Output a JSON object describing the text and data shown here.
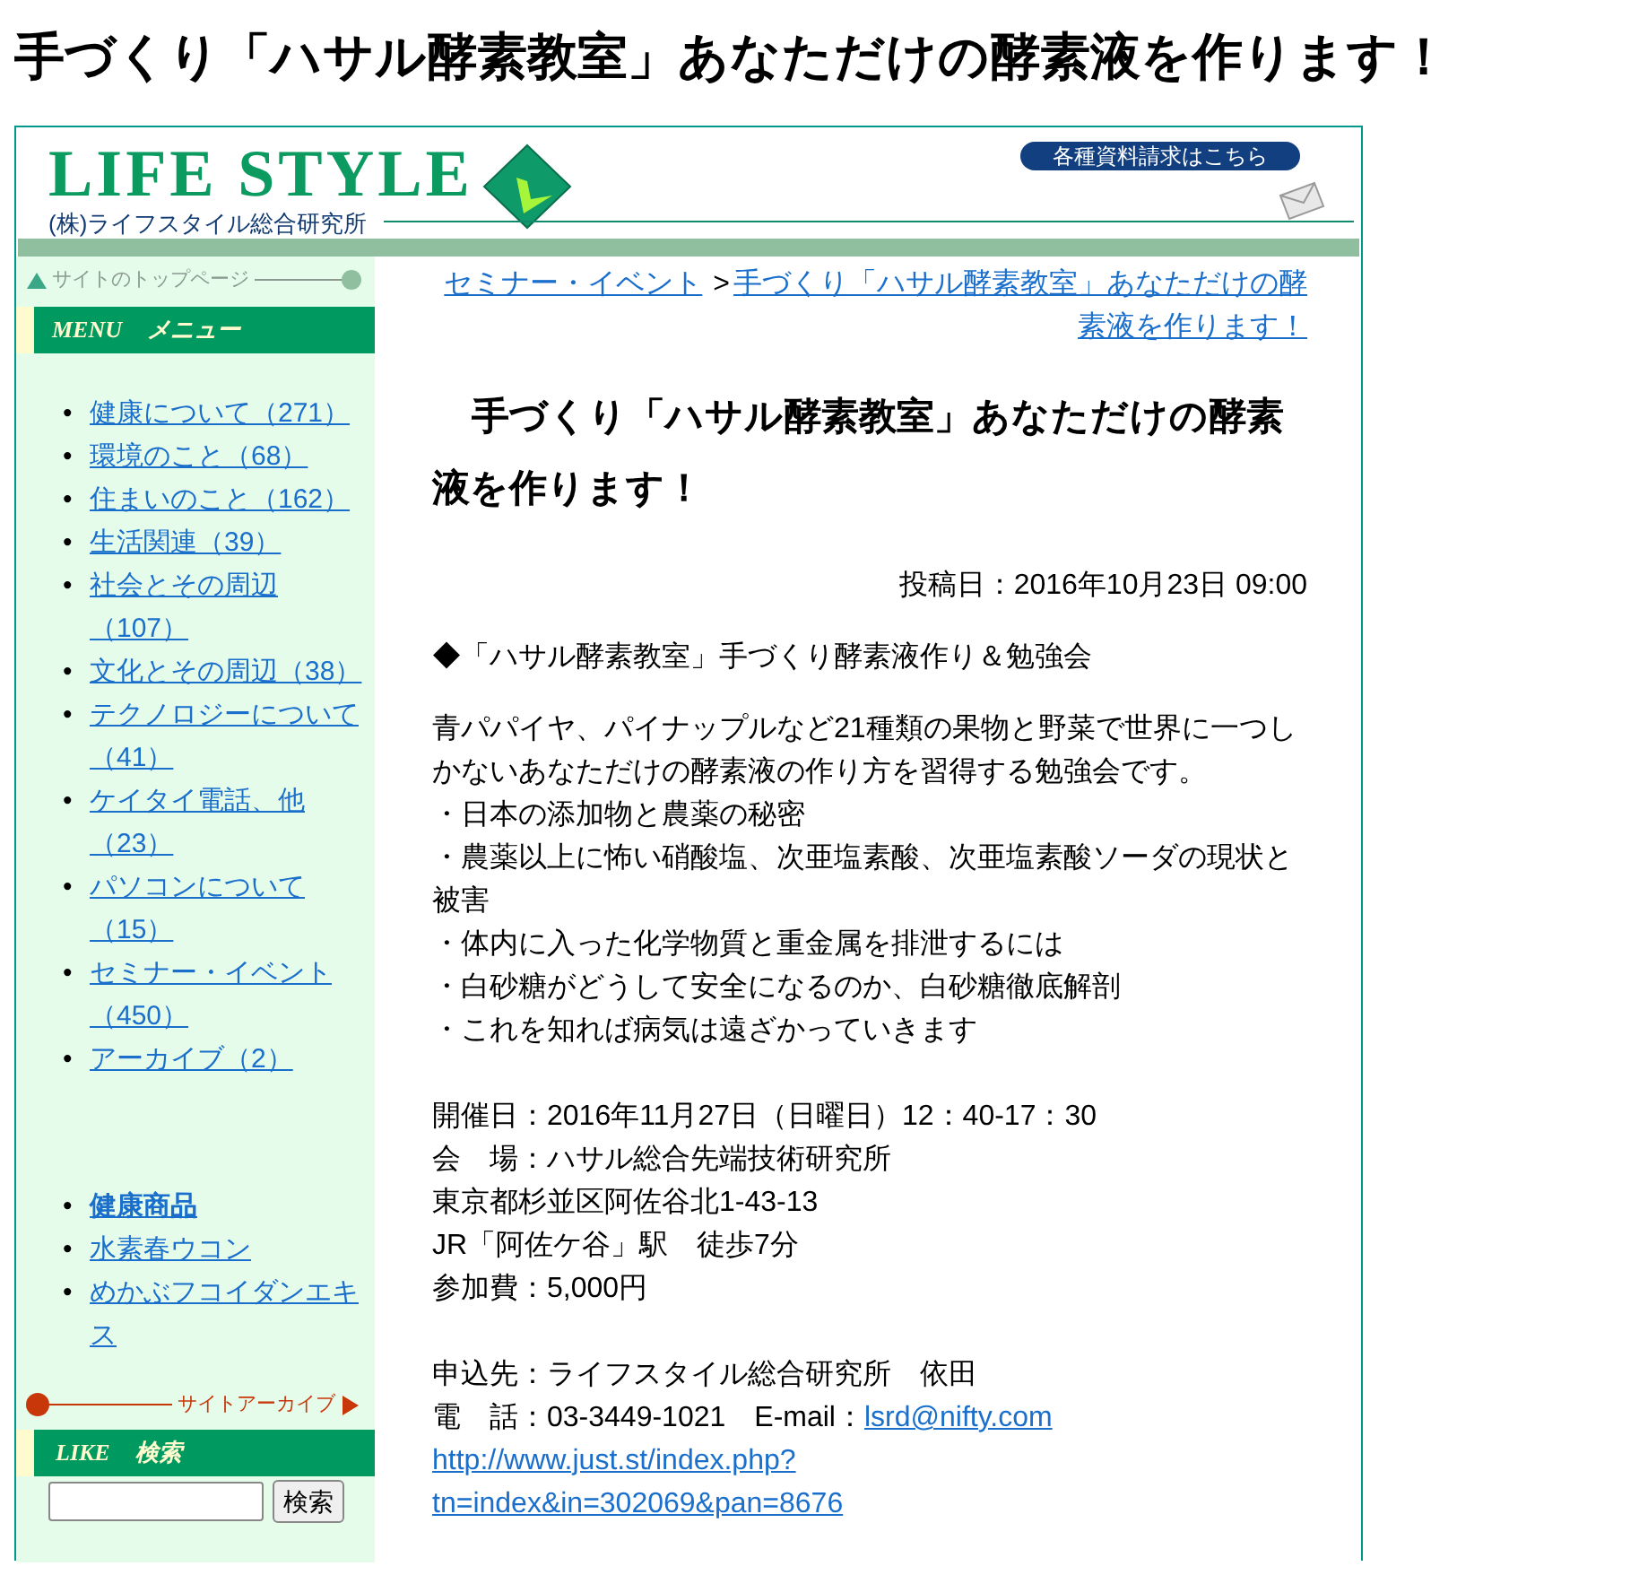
{
  "page_title": "手づくり「ハサル酵素教室」あなただけの酵素液を作ります！",
  "header": {
    "logo_text": "LIFE STYLE",
    "company": "(株)ライフスタイル総合研究所",
    "request_button": "各種資料請求はこちら"
  },
  "sidebar": {
    "top_link": "サイトのトップページ",
    "menu_heading": {
      "en": "MENU",
      "ja": "メニュー"
    },
    "menu_items": [
      "健康について（271）",
      "環境のこと（68）",
      "住まいのこと（162）",
      "生活関連（39）",
      "社会とその周辺（107）",
      "文化とその周辺（38）",
      "テクノロジーについて（41）",
      "ケイタイ電話、他（23）",
      "パソコンについて（15）",
      "セミナー・イベント（450）",
      "アーカイブ（2）"
    ],
    "products": [
      {
        "label": "健康商品",
        "bold": true
      },
      {
        "label": "水素春ウコン",
        "bold": false
      },
      {
        "label": "めかぶフコイダンエキス",
        "bold": false
      }
    ],
    "bullet": "•",
    "archive_link": "サイトアーカイブ",
    "search_heading": {
      "en": "LIKE",
      "ja": "検索"
    },
    "search_button": "検索"
  },
  "content": {
    "breadcrumb": [
      "セミナー・イベント",
      "手づくり「ハサル酵素教室」あなただけの酵素液を作ります！"
    ],
    "breadcrumb_separator": ">",
    "title": "手づくり「ハサル酵素教室」あなただけの酵素液を作ります！",
    "posted": "投稿日：2016年10月23日 09:00",
    "subtitle": "◆「ハサル酵素教室」手づくり酵素液作り＆勉強会",
    "blocks": [
      [
        "青パパイヤ、パイナップルなど21種類の果物と野菜で世界に一つしかないあなただけの酵素液の作り方を習得する勉強会です。",
        "・日本の添加物と農薬の秘密",
        "・農薬以上に怖い硝酸塩、次亜塩素酸、次亜塩素酸ソーダの現状と被害",
        "・体内に入った化学物質と重金属を排泄するには",
        "・白砂糖がどうして安全になるのか、白砂糖徹底解剖",
        "・これを知れば病気は遠ざかっていきます"
      ],
      [
        "開催日：2016年11月27日（日曜日）12：40-17：30",
        "会　場：ハサル総合先端技術研究所",
        "東京都杉並区阿佐谷北1-43-13",
        "JR「阿佐ケ谷」駅　徒歩7分",
        "参加費：5,000円"
      ],
      [
        "申込先：ライフスタイル総合研究所　依田"
      ]
    ],
    "contact": {
      "phone_line": "電　話：03-3449-1021　E-mail：",
      "email": "lsrd@nifty.com",
      "url": "http://www.just.st/index.php?tn=index&in=302069&pan=8676"
    }
  }
}
